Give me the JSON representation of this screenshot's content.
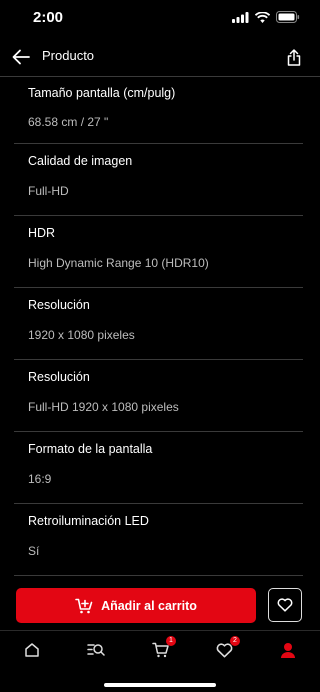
{
  "status_bar": {
    "time": "2:00"
  },
  "header": {
    "title": "Producto",
    "back_icon": "arrow-left-icon",
    "share_icon": "share-icon"
  },
  "specs": [
    {
      "label": "Tamaño pantalla (cm/pulg)",
      "value": "68.58 cm / 27 \""
    },
    {
      "label": "Calidad de imagen",
      "value": "Full-HD"
    },
    {
      "label": "HDR",
      "value": "High Dynamic Range 10 (HDR10)"
    },
    {
      "label": "Resolución",
      "value": "1920 x 1080 pixeles"
    },
    {
      "label": "Resolución",
      "value": "Full-HD 1920 x 1080 pixeles"
    },
    {
      "label": "Formato de la pantalla",
      "value": "16:9"
    },
    {
      "label": "Retroiluminación LED",
      "value": "Sí"
    }
  ],
  "actions": {
    "add_to_cart_label": "Añadir al carrito",
    "accent_color": "#e30613"
  },
  "tabbar": {
    "cart_badge": "1",
    "wishlist_badge": "2",
    "items": [
      "home-icon",
      "search-list-icon",
      "cart-icon",
      "heart-icon",
      "account-icon"
    ]
  }
}
